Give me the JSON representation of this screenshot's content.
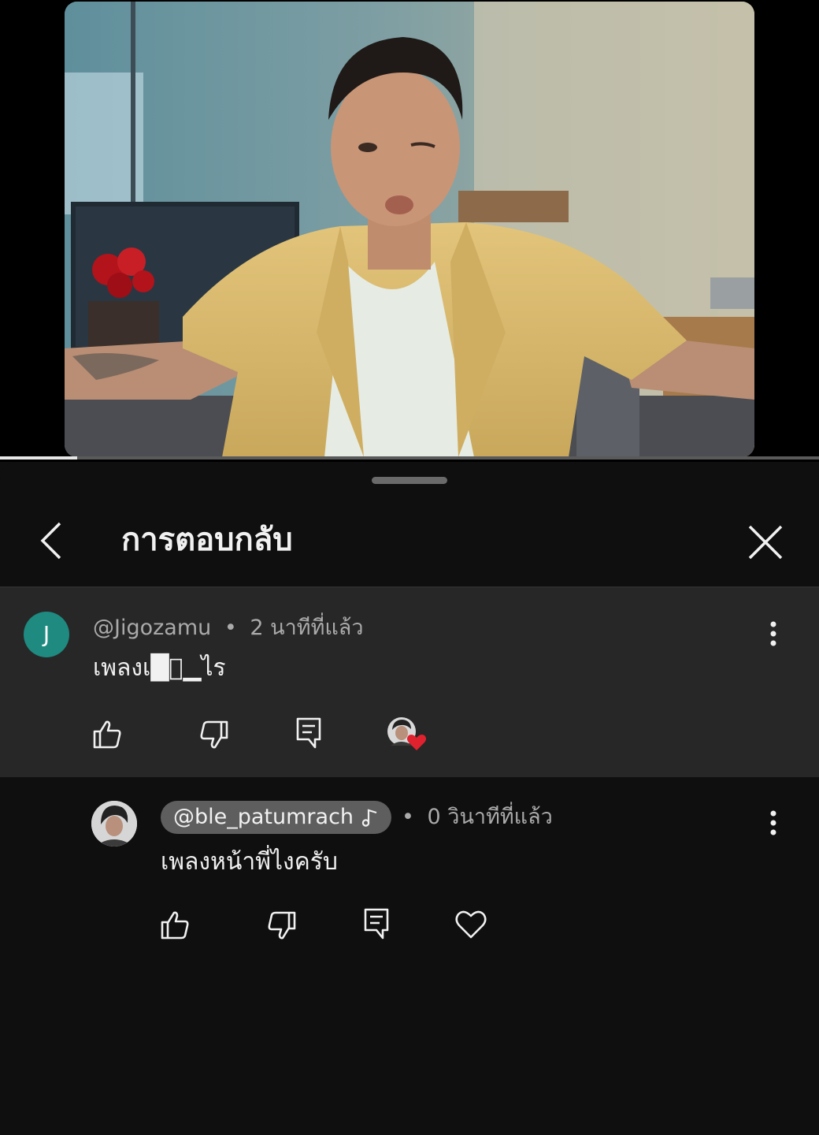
{
  "video": {
    "progress_percent": 9.4,
    "colors": {
      "frame_background": "#000000",
      "jacket": "#d8b76a"
    }
  },
  "header": {
    "title": "การตอบกลับ",
    "back_icon": "chevron-left-icon",
    "close_icon": "close-icon"
  },
  "comments": [
    {
      "author": "@Jigozamu",
      "avatar_letter": "J",
      "avatar_color": "#1e8a80",
      "separator": "•",
      "time": "2 นาทีที่แล้ว",
      "text": "เพลงเ█้▁ไร",
      "actions": [
        "like-icon",
        "dislike-icon",
        "reply-icon"
      ],
      "creator_hearted": true,
      "heart_color": "#e0222e"
    },
    {
      "author": "@ble_patumrach",
      "author_badge_icon": "music-note-icon",
      "separator": "•",
      "time": "0 วินาทีที่แล้ว",
      "text": "เพลงหน้าพี่ไงครับ",
      "actions": [
        "like-icon",
        "dislike-icon",
        "reply-icon",
        "heart-icon"
      ]
    }
  ]
}
